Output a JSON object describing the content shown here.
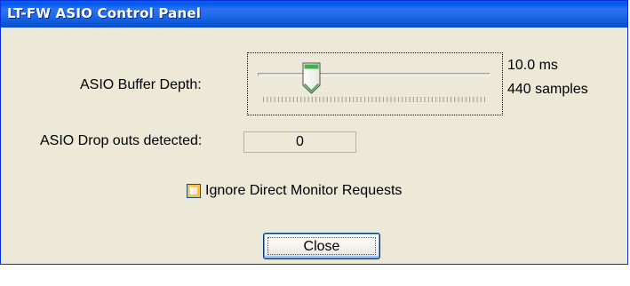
{
  "window": {
    "title": "LT-FW ASIO Control Panel"
  },
  "buffer": {
    "label": "ASIO Buffer Depth:",
    "latency": "10.0 ms",
    "samples": "440 samples",
    "slider_fraction": 0.23
  },
  "dropouts": {
    "label": "ASIO Drop outs detected:",
    "value": "0"
  },
  "monitor": {
    "label": "Ignore Direct Monitor Requests",
    "checked": false
  },
  "buttons": {
    "close_label": "Close"
  },
  "colors": {
    "titlebar": "#0a5ee8",
    "dialog_bg": "#ece9d8",
    "thumb_green": "#3cb44a",
    "checkbox_orange": "#f0a62a"
  },
  "icons": {
    "slider_thumb": "slider-thumb-icon"
  }
}
